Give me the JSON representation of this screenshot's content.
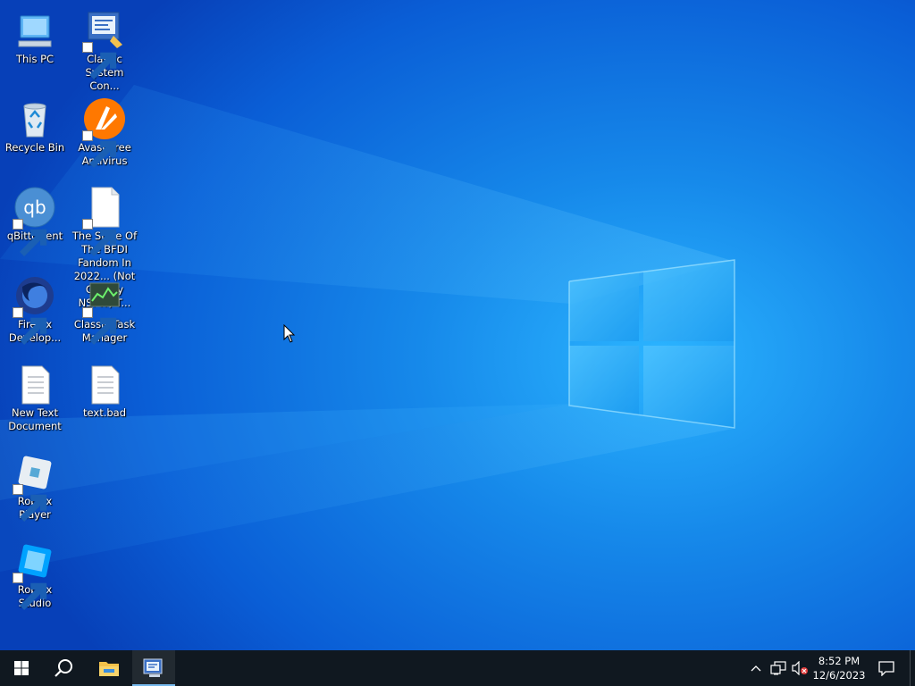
{
  "desktop": {
    "icons": [
      {
        "label": "This PC",
        "name": "desktop-icon-this-pc"
      },
      {
        "label": "Classic System Con...",
        "name": "desktop-icon-classic-system-control"
      },
      {
        "label": "Recycle Bin",
        "name": "desktop-icon-recycle-bin"
      },
      {
        "label": "Avast Free Antivirus",
        "name": "desktop-icon-avast"
      },
      {
        "label": "qBittorrent",
        "name": "desktop-icon-qbittorrent"
      },
      {
        "label": "The State Of The BFDI Fandom In 2022... (Not Overtly NSFW) T...",
        "name": "desktop-icon-bfdi-document"
      },
      {
        "label": "Firefox Develop...",
        "name": "desktop-icon-firefox-developer"
      },
      {
        "label": "Classic Task Manager",
        "name": "desktop-icon-classic-task-manager"
      },
      {
        "label": "New Text Document",
        "name": "desktop-icon-new-text-document"
      },
      {
        "label": "text.bad",
        "name": "desktop-icon-text-bad"
      },
      {
        "label": "Roblox Player",
        "name": "desktop-icon-roblox-player"
      },
      {
        "label": "Roblox Studio",
        "name": "desktop-icon-roblox-studio"
      }
    ]
  },
  "taskbar": {
    "start_icon": "windows-logo-icon",
    "search_icon": "search-icon",
    "pinned": [
      {
        "name": "file-explorer-icon"
      },
      {
        "name": "system-control-icon",
        "active": true
      }
    ],
    "tray": {
      "overflow_icon": "chevron-up-icon",
      "network_icon": "network-icon",
      "volume_icon": "volume-muted-icon",
      "notification_icon": "action-center-icon"
    },
    "clock": {
      "time": "8:52 PM",
      "date": "12/6/2023"
    }
  },
  "colors": {
    "wallpaper_dark": "#0a3fb0",
    "wallpaper_light": "#1aa0f2",
    "taskbar": "#101820",
    "accent": "#76b9ed"
  }
}
